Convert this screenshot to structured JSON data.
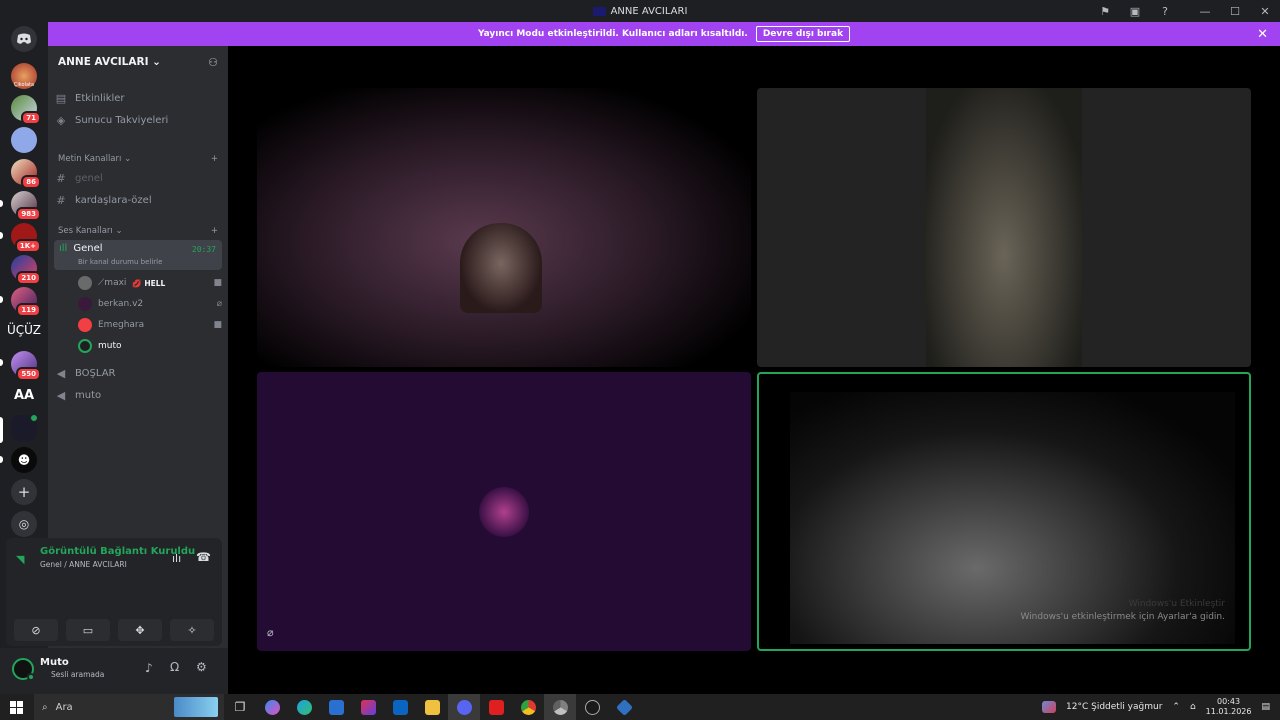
{
  "window": {
    "title": "ANNE AVCILARI"
  },
  "announcement": {
    "text": "Yayıncı Modu etkinleştirildi. Kullanıcı adları kısaltıldı.",
    "button": "Devre dışı bırak"
  },
  "server_rail": {
    "badges": [
      "71",
      "86",
      "983",
      "1K+",
      "210",
      "119",
      "550"
    ],
    "labels": [
      "ÜÇÜZ",
      "AA"
    ],
    "avatar_text": "Çikolata"
  },
  "guild": {
    "name": "ANNE AVCILARI"
  },
  "nav": {
    "events": "Etkinlikler",
    "boosts": "Sunucu Takviyeleri"
  },
  "text_category": {
    "name": "Metin Kanalları",
    "channels": [
      "genel",
      "kardaşlara-özel"
    ]
  },
  "voice_category": {
    "name": "Ses Kanalları"
  },
  "active_voice": {
    "name": "Genel",
    "time": "20:37",
    "status": "Bir kanal durumu belirle"
  },
  "members": [
    {
      "name": "⟋maxi",
      "tag": "💋 HELL"
    },
    {
      "name": "berkan.v2",
      "tag": ""
    },
    {
      "name": "Emeghara",
      "tag": ""
    },
    {
      "name": "muto",
      "tag": ""
    }
  ],
  "other_voice": [
    "BOŞLAR",
    "muto"
  ],
  "connection": {
    "title": "Görüntülü Bağlantı Kuruldu",
    "sub": "Genel / ANNE AVCILARI"
  },
  "user": {
    "name": "Muto",
    "status": "Sesli aramada"
  },
  "windows_watermark": {
    "line1": "Windows'u Etkinleştir",
    "line2": "Windows'u etkinleştirmek için Ayarlar'a gidin."
  },
  "taskbar": {
    "search": "Ara",
    "weather": "12°C  Şiddetli yağmur",
    "time": "00:43",
    "date": "11.01.2026"
  },
  "colors": {
    "accent": "#a143f0",
    "green": "#23a55a",
    "blurple": "#5865f2",
    "red": "#f23f43"
  }
}
